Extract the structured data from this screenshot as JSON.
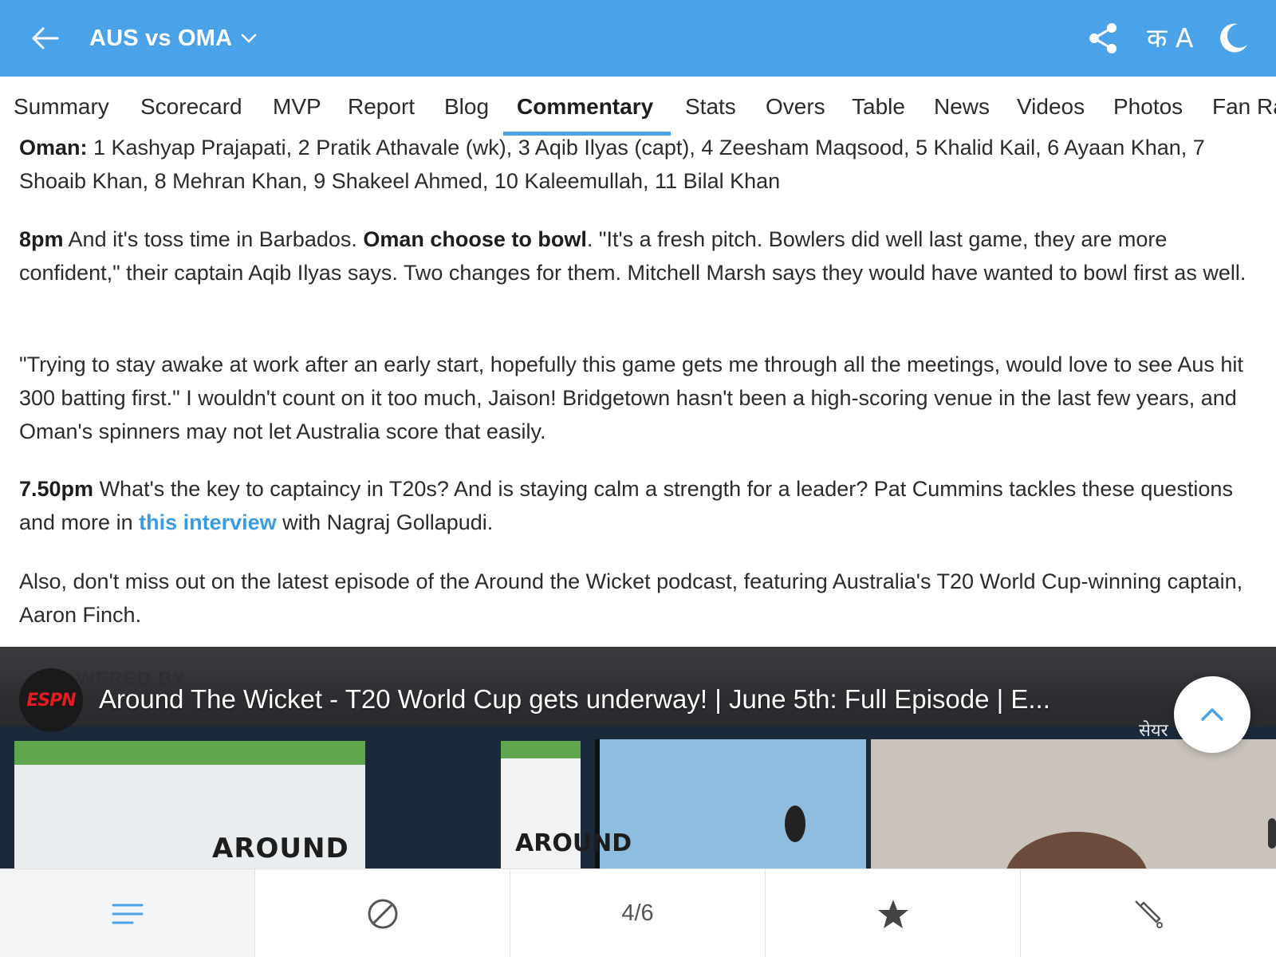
{
  "header": {
    "title": "AUS vs OMA",
    "lang_label": "क A",
    "accent_color": "#4aa3e8"
  },
  "tabs": [
    {
      "label": "Summary"
    },
    {
      "label": "Scorecard"
    },
    {
      "label": "MVP"
    },
    {
      "label": "Report"
    },
    {
      "label": "Blog"
    },
    {
      "label": "Commentary",
      "active": true
    },
    {
      "label": "Stats"
    },
    {
      "label": "Overs"
    },
    {
      "label": "Table"
    },
    {
      "label": "News"
    },
    {
      "label": "Videos"
    },
    {
      "label": "Photos"
    },
    {
      "label": "Fan Ra"
    }
  ],
  "commentary": {
    "lineup": {
      "team": "Oman:",
      "text": " 1 Kashyap Prajapati, 2 Pratik Athavale (wk), 3 Aqib Ilyas (capt), 4 Zeesham Maqsood, 5 Khalid Kail, 6 Ayaan Khan, 7 Shoaib Khan, 8 Mehran Khan, 9 Shakeel Ahmed, 10 Kaleemullah, 11 Bilal Khan"
    },
    "toss": {
      "time": "8pm",
      "text1": " And it's toss time in Barbados. ",
      "highlight": "Oman choose to bowl",
      "text2": ". \"It's a fresh pitch. Bowlers did well last game, they are more confident,\" their captain Aqib Ilyas says. Two changes for them. Mitchell Marsh says they would have wanted to bowl first as well."
    },
    "fan": {
      "text": "\"Trying to stay awake at work after an early start, hopefully this game gets me through all the meetings, would love to see Aus hit 300 batting first.\" I wouldn't count on it too much, Jaison! Bridgetown hasn't been a high-scoring venue in the last few years, and Oman's spinners may not let Australia score that easily."
    },
    "captaincy": {
      "time": "7.50pm",
      "text1": " What's the key to captaincy in T20s? And is staying calm a strength for a leader? Pat Cummins tackles these questions and more in ",
      "link": "this interview",
      "text2": " with Nagraj Gollapudi."
    },
    "podcast": {
      "text": "Also, don't miss out on the latest episode of the Around the Wicket podcast, featuring Australia's T20 World Cup-winning captain, Aaron Finch."
    }
  },
  "video": {
    "channel_logo": "ESPN",
    "powered_by": "WERED BY",
    "title": "Around The Wicket - T20 World Cup gets underway! | June 5th: Full Episode | E...",
    "share_label": "सेयर",
    "sign_text_1": "AROUND",
    "sign_text_2": "AROUND"
  },
  "bottom_nav": {
    "items": [
      {
        "icon": "menu-icon",
        "active": true
      },
      {
        "icon": "ball-icon"
      },
      {
        "icon": "page-counter",
        "label": "4/6"
      },
      {
        "icon": "star-icon"
      },
      {
        "icon": "bat-icon"
      }
    ]
  }
}
